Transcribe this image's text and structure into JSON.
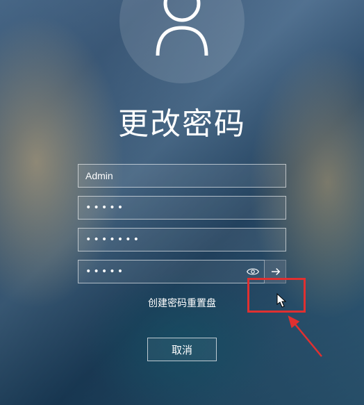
{
  "title": "更改密码",
  "username_field": {
    "value": "Admin"
  },
  "old_password": {
    "masked": "•••••"
  },
  "new_password": {
    "masked": "•••••••"
  },
  "confirm_password": {
    "masked": "•••••"
  },
  "reset_link": "创建密码重置盘",
  "cancel_label": "取消",
  "icons": {
    "avatar": "user-icon",
    "reveal": "eye-icon",
    "submit": "arrow-right-icon"
  }
}
